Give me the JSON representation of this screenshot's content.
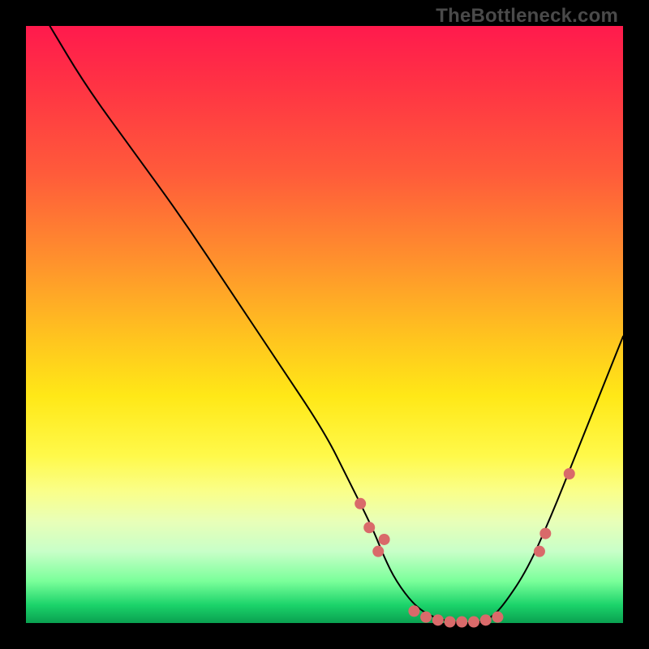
{
  "watermark": "TheBottleneck.com",
  "chart_data": {
    "type": "line",
    "title": "",
    "xlabel": "",
    "ylabel": "",
    "xlim": [
      0,
      100
    ],
    "ylim": [
      0,
      100
    ],
    "series": [
      {
        "name": "curve",
        "x": [
          4,
          10,
          18,
          26,
          34,
          42,
          50,
          54,
          58,
          60,
          62,
          65,
          68,
          72,
          76,
          78,
          80,
          84,
          88,
          92,
          96,
          100
        ],
        "y": [
          100,
          90,
          79,
          68,
          56,
          44,
          32,
          24,
          16,
          11,
          7,
          3,
          1,
          0,
          0,
          1,
          3,
          9,
          18,
          28,
          38,
          48
        ]
      }
    ],
    "annotations": {
      "dots": [
        {
          "x": 56,
          "y": 20
        },
        {
          "x": 57.5,
          "y": 16
        },
        {
          "x": 59,
          "y": 12
        },
        {
          "x": 60,
          "y": 14
        },
        {
          "x": 65,
          "y": 2
        },
        {
          "x": 67,
          "y": 1
        },
        {
          "x": 69,
          "y": 0.5
        },
        {
          "x": 71,
          "y": 0.2
        },
        {
          "x": 73,
          "y": 0.2
        },
        {
          "x": 75,
          "y": 0.2
        },
        {
          "x": 77,
          "y": 0.5
        },
        {
          "x": 79,
          "y": 1
        },
        {
          "x": 86,
          "y": 12
        },
        {
          "x": 87,
          "y": 15
        },
        {
          "x": 91,
          "y": 25
        }
      ]
    },
    "background_gradient": {
      "top": "#ff1a4d",
      "mid": "#ffe817",
      "bottom": "#0aa050"
    }
  }
}
